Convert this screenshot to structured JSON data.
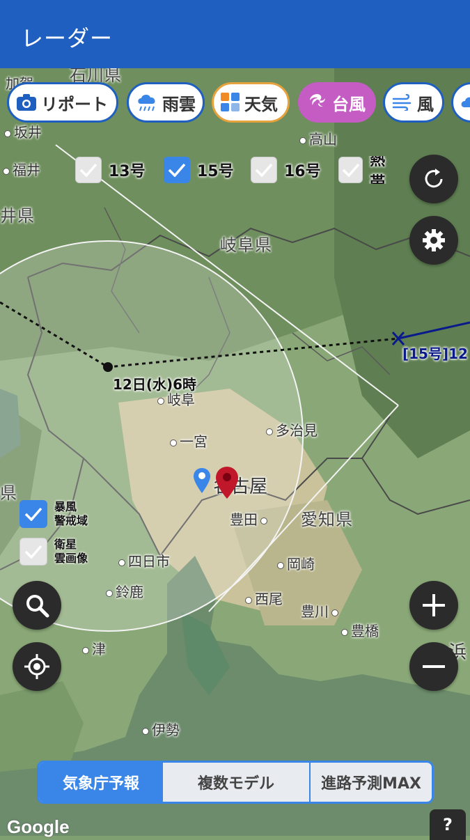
{
  "app": {
    "title": "レーダー"
  },
  "layers": [
    {
      "label": "リポート",
      "icon": "camera-icon"
    },
    {
      "label": "雨雲",
      "icon": "rain-cloud-icon"
    },
    {
      "label": "天気",
      "icon": "weather-tiles-icon"
    },
    {
      "label": "台風",
      "icon": "typhoon-icon",
      "active": true
    },
    {
      "label": "風",
      "icon": "wind-icon"
    }
  ],
  "typhoon_checks": [
    {
      "label": "13号",
      "checked": false
    },
    {
      "label": "15号",
      "checked": true
    },
    {
      "label": "16号",
      "checked": false
    },
    {
      "label": "熱帯",
      "checked": false
    }
  ],
  "map_toggles": [
    {
      "label": "暴風警戒域",
      "line1": "暴風",
      "line2": "警戒域",
      "checked": true
    },
    {
      "label": "衛星雲画像",
      "line1": "衛星",
      "line2": "雲画像",
      "checked": false
    }
  ],
  "typhoon": {
    "track_label": "12日(水)6時",
    "current_label": "[15号]12"
  },
  "places": {
    "ishikawa": "石川県",
    "kaga": "加賀",
    "sakai": "坂井",
    "fukui": "福井",
    "fukui_pref": "井県",
    "shiga_pref": "県",
    "takayama": "高山",
    "gifu_pref": "岐阜県",
    "gifu": "岐阜",
    "tajimi": "多治見",
    "ichinomiya": "一宮",
    "nagoya": "名古屋",
    "toyota": "豊田",
    "aichi_pref": "愛知県",
    "yokkaichi": "四日市",
    "okazaki": "岡崎",
    "suzuka": "鈴鹿",
    "nishio": "西尾",
    "toyokawa": "豊川",
    "toyohashi": "豊橋",
    "tsu": "津",
    "hama": "浜",
    "ise": "伊勢"
  },
  "forecast_tabs": [
    {
      "label": "気象庁予報",
      "active": true
    },
    {
      "label": "複数モデル",
      "active": false
    },
    {
      "label": "進路予測MAX",
      "active": false
    }
  ],
  "attribution": "Google",
  "help_label": "?",
  "colors": {
    "appbar": "#1f5fbf",
    "typhoon_chip": "#c45cc4",
    "check_on": "#3a86e8"
  }
}
